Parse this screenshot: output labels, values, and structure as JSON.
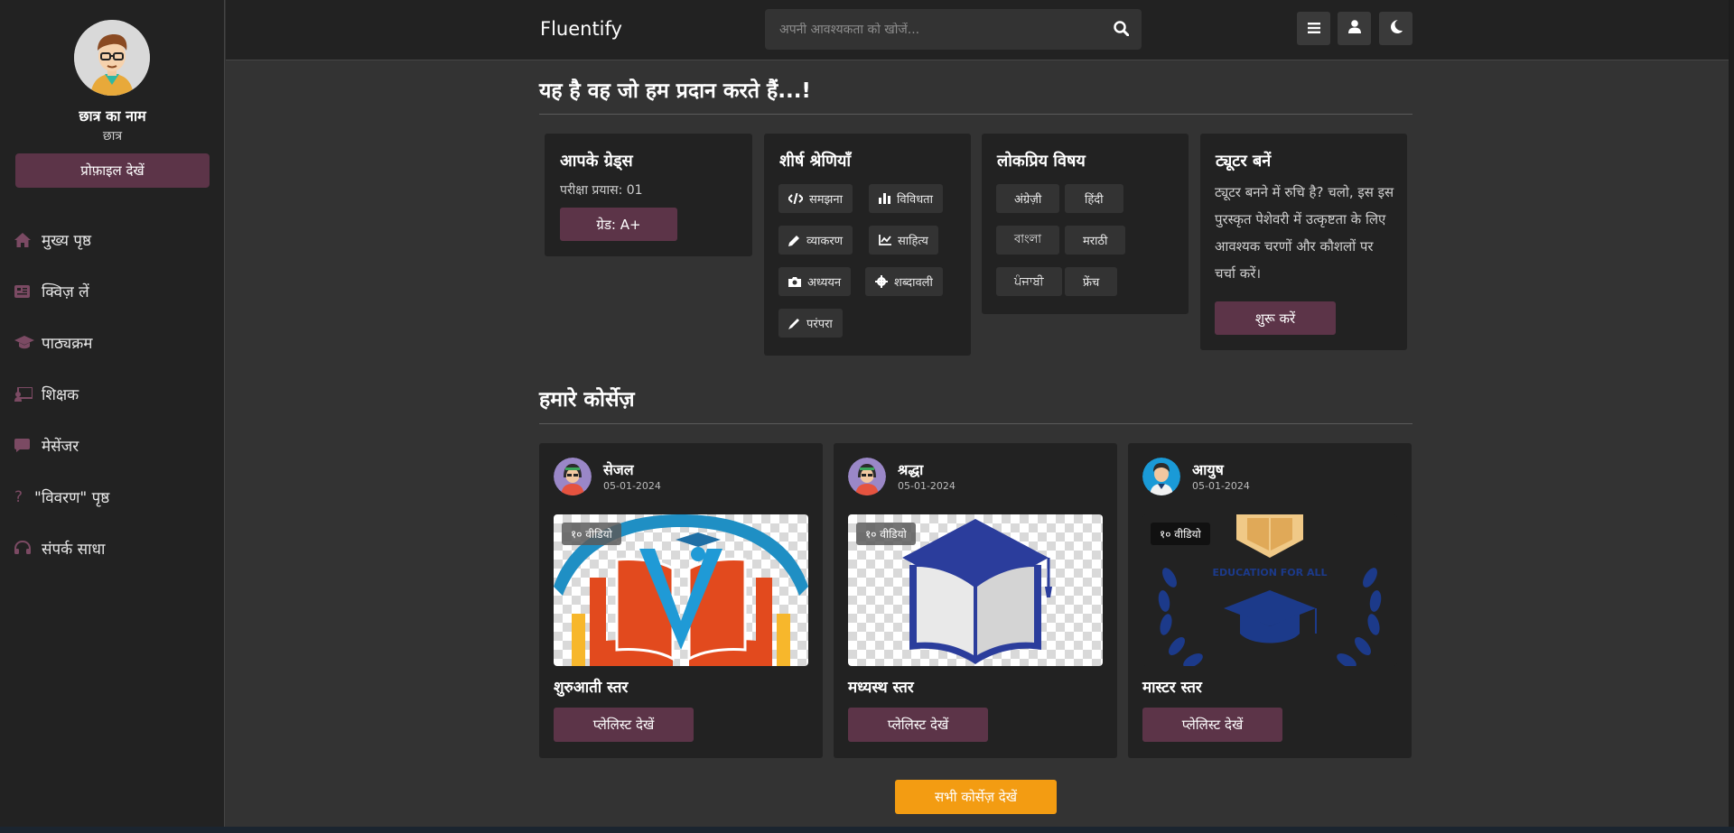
{
  "student": {
    "name": "छात्र का नाम",
    "role": "छात्र",
    "profile_button": "प्रोफ़ाइल देखें"
  },
  "sidebar": {
    "items": [
      {
        "label": "मुख्य पृष्ठ",
        "icon": "home-icon"
      },
      {
        "label": "क्विज़ लें",
        "icon": "quiz-icon"
      },
      {
        "label": "पाठ्यक्रम",
        "icon": "graduation-cap-icon"
      },
      {
        "label": "शिक्षक",
        "icon": "teacher-icon"
      },
      {
        "label": "मेसेंजर",
        "icon": "chat-icon"
      },
      {
        "label": "\"विवरण\" पृष्ठ",
        "icon": "question-icon"
      },
      {
        "label": "संपर्क साधा",
        "icon": "headset-icon"
      }
    ]
  },
  "header": {
    "brand": "Fluentify",
    "search_placeholder": "अपनी आवश्यकता को खोजें...",
    "buttons": [
      "menu-icon",
      "user-icon",
      "moon-icon"
    ]
  },
  "offer": {
    "title": "यह है वह जो हम प्रदान करते हैं...!",
    "grades": {
      "title": "आपके ग्रेड्स",
      "attempts": "परीक्षा प्रयास: 01",
      "grade_button": "ग्रेड: A+"
    },
    "categories": {
      "title": "शीर्ष श्रेणियाँ",
      "items": [
        {
          "label": "समझना",
          "icon": "code-icon"
        },
        {
          "label": "विविधता",
          "icon": "bar-chart-icon"
        },
        {
          "label": "व्याकरण",
          "icon": "pencil-icon"
        },
        {
          "label": "साहित्य",
          "icon": "line-chart-icon"
        },
        {
          "label": "अध्ययन",
          "icon": "camera-icon"
        },
        {
          "label": "शब्दावली",
          "icon": "gear-icon"
        },
        {
          "label": "परंपरा",
          "icon": "brush-icon"
        }
      ]
    },
    "subjects": {
      "title": "लोकप्रिय विषय",
      "items": [
        "अंग्रेज़ी",
        "हिंदी",
        "বাংলা",
        "मराठी",
        "ਪੰਜਾਬੀ",
        "फ्रेंच"
      ]
    },
    "tutor": {
      "title": "ट्यूटर बनें",
      "text": "ट्यूटर बनने में रुचि है? चलो, इस इस पुरस्कृत पेशेवरी में उत्कृष्टता के लिए आवश्यक चरणों और कौशलों पर चर्चा करें।",
      "button": "शुरू करें"
    }
  },
  "courses": {
    "title": "हमारे कोर्सेज़",
    "items": [
      {
        "author": "सेजल",
        "date": "05-01-2024",
        "badge": "१० वीडियो",
        "level": "शुरुआती स्तर",
        "button": "प्लेलिस्ट देखें"
      },
      {
        "author": "श्रद्धा",
        "date": "05-01-2024",
        "badge": "१० वीडियो",
        "level": "मध्यस्थ स्तर",
        "button": "प्लेलिस्ट देखें"
      },
      {
        "author": "आयुष",
        "date": "05-01-2024",
        "badge": "१० वीडियो",
        "level": "मास्टर स्तर",
        "button": "प्लेलिस्ट देखें",
        "logo_text": "EDUCATION FOR ALL"
      }
    ],
    "view_all": "सभी कोर्सेज़ देखें"
  },
  "colors": {
    "accent": "#5c3448",
    "orange": "#f39c12",
    "panel": "#222222",
    "bg": "#333333"
  }
}
